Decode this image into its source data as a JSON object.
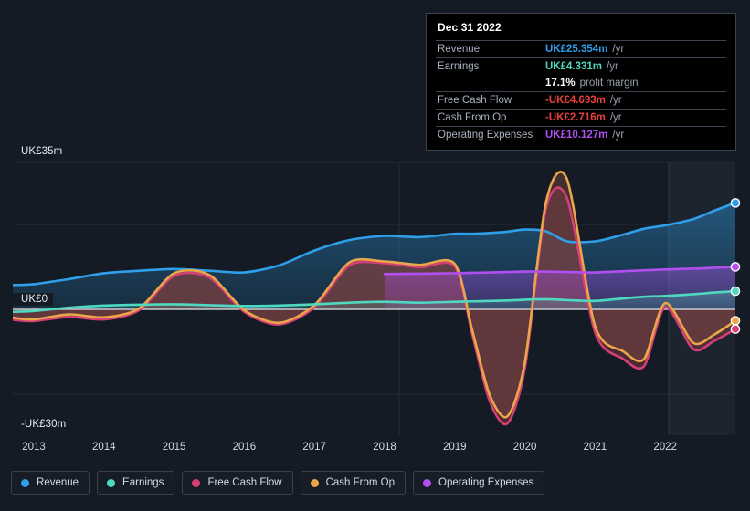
{
  "axis": {
    "y_top_label": "UK£35m",
    "y_zero_label": "UK£0",
    "y_bottom_label": "-UK£30m",
    "x_ticks": [
      "2013",
      "2014",
      "2015",
      "2016",
      "2017",
      "2018",
      "2019",
      "2020",
      "2021",
      "2022"
    ]
  },
  "tooltip": {
    "date": "Dec 31 2022",
    "rows": [
      {
        "name": "Revenue",
        "value": "UK£25.354m",
        "unit": "/yr",
        "color": "#2f9fea"
      },
      {
        "name": "Earnings",
        "value": "UK£4.331m",
        "unit": "/yr",
        "color": "#4fd9c0"
      },
      {
        "name": "",
        "value": "17.1%",
        "unit": "profit margin",
        "color": "#ffffff"
      },
      {
        "name": "Free Cash Flow",
        "value": "-UK£4.693m",
        "unit": "/yr",
        "color": "#e8413c"
      },
      {
        "name": "Cash From Op",
        "value": "-UK£2.716m",
        "unit": "/yr",
        "color": "#e8413c"
      },
      {
        "name": "Operating Expenses",
        "value": "UK£10.127m",
        "unit": "/yr",
        "color": "#b14ff0"
      }
    ]
  },
  "legend": {
    "items": [
      {
        "label": "Revenue",
        "color": "#2f9fea"
      },
      {
        "label": "Earnings",
        "color": "#4fd9c0"
      },
      {
        "label": "Free Cash Flow",
        "color": "#d63f76"
      },
      {
        "label": "Cash From Op",
        "color": "#e9a74a"
      },
      {
        "label": "Operating Expenses",
        "color": "#b14ff0"
      }
    ]
  },
  "chart_data": {
    "type": "area",
    "title": "",
    "xlabel": "",
    "ylabel": "UK£ (millions)",
    "ylim": [
      -30,
      35
    ],
    "xlim": [
      2012.7,
      2023.0
    ],
    "grid": true,
    "legend_position": "bottom",
    "currency": "UK£",
    "units": "millions per year",
    "zero_line": 0,
    "x": [
      2012.7,
      2013.0,
      2013.5,
      2014.0,
      2014.5,
      2015.0,
      2015.5,
      2016.0,
      2016.5,
      2017.0,
      2017.5,
      2018.0,
      2018.5,
      2019.0,
      2019.25,
      2019.5,
      2019.75,
      2020.0,
      2020.3,
      2020.6,
      2021.0,
      2021.4,
      2021.7,
      2022.0,
      2022.4,
      2022.7,
      2023.0
    ],
    "series": [
      {
        "name": "Revenue",
        "color": "#2f9fea",
        "values": [
          5.8,
          6.0,
          7.2,
          8.6,
          9.2,
          9.6,
          9.2,
          8.8,
          10.5,
          14.0,
          16.5,
          17.5,
          17.2,
          18.0,
          18.0,
          18.2,
          18.5,
          19.0,
          18.6,
          16.2,
          16.2,
          17.8,
          19.2,
          20.0,
          21.5,
          23.5,
          25.354
        ],
        "endpoint_label": "UK£25.354m"
      },
      {
        "name": "Earnings",
        "color": "#4fd9c0",
        "values": [
          -0.6,
          -0.4,
          0.4,
          0.9,
          1.1,
          1.2,
          1.0,
          0.8,
          0.9,
          1.2,
          1.6,
          1.8,
          1.6,
          1.8,
          1.9,
          2.0,
          2.1,
          2.3,
          2.4,
          2.2,
          2.0,
          2.6,
          3.0,
          3.2,
          3.6,
          4.0,
          4.331
        ],
        "endpoint_label": "UK£4.331m"
      },
      {
        "name": "Free Cash Flow",
        "color": "#d63f76",
        "values": [
          -2.5,
          -2.8,
          -1.8,
          -2.4,
          -0.2,
          8.0,
          7.6,
          -0.6,
          -3.6,
          0.5,
          10.5,
          11.0,
          10.0,
          10.2,
          -6.0,
          -22.0,
          -27.2,
          -14.0,
          24.0,
          26.5,
          -5.5,
          -11.8,
          -13.5,
          0.5,
          -9.5,
          -7.5,
          -4.693
        ],
        "endpoint_label": "-UK£4.693m"
      },
      {
        "name": "Cash From Op",
        "color": "#e9a74a",
        "values": [
          -2.0,
          -2.4,
          -1.2,
          -1.9,
          0.2,
          8.6,
          8.2,
          -0.2,
          -3.2,
          1.0,
          11.2,
          11.4,
          10.6,
          10.8,
          -5.0,
          -20.5,
          -25.5,
          -12.5,
          25.5,
          31.0,
          -4.0,
          -10.0,
          -11.8,
          1.5,
          -8.0,
          -6.0,
          -2.716
        ],
        "endpoint_label": "-UK£2.716m"
      },
      {
        "name": "Operating Expenses",
        "color": "#b14ff0",
        "values": [
          null,
          null,
          null,
          null,
          null,
          null,
          null,
          null,
          null,
          null,
          null,
          8.4,
          8.5,
          8.6,
          8.7,
          8.8,
          8.9,
          9.0,
          9.0,
          8.9,
          8.8,
          9.1,
          9.3,
          9.5,
          9.7,
          9.9,
          10.127
        ],
        "endpoint_label": "UK£10.127m",
        "starts_at": 2018.0
      }
    ],
    "highlight_band": {
      "from": 2022.0,
      "to": 2023.0,
      "note": "lighter shaded region at right"
    }
  }
}
